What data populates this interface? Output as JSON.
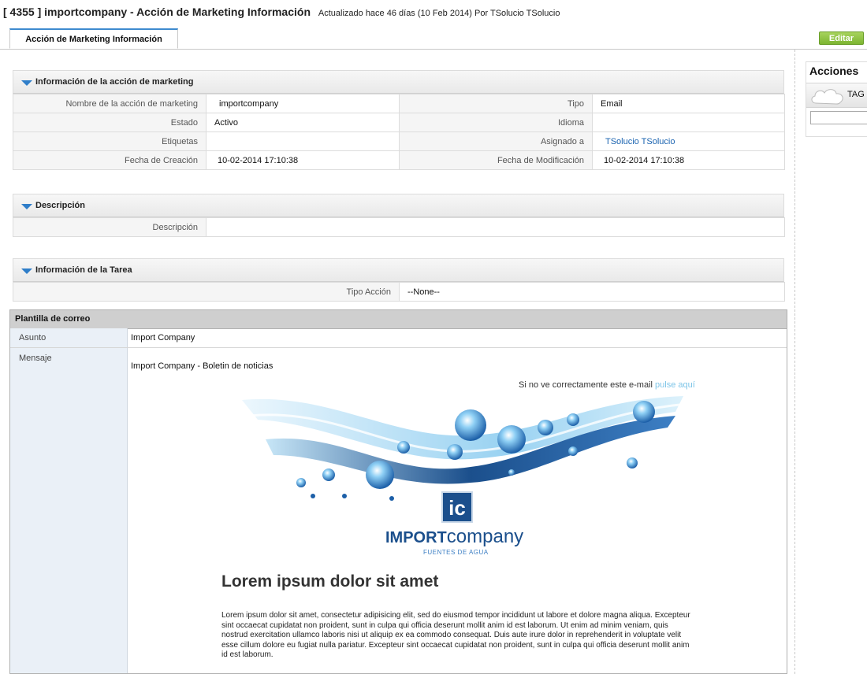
{
  "header": {
    "title": "[ 4355 ] importcompany - Acción de Marketing Información",
    "updated": "Actualizado hace 46 días (10 Feb 2014) Por TSolucio TSolucio"
  },
  "tabs": [
    {
      "label": "Acción de Marketing Información"
    }
  ],
  "edit_button": "Editar",
  "sections": {
    "marketing": {
      "title": "Información de la acción de marketing",
      "rows": [
        {
          "l1": "Nombre de la acción de marketing",
          "v1": "importcompany",
          "l2": "Tipo",
          "v2": "Email"
        },
        {
          "l1": "Estado",
          "v1": "Activo",
          "l2": "Idioma",
          "v2": ""
        },
        {
          "l1": "Etiquetas",
          "v1": "",
          "l2": "Asignado a",
          "v2": "TSolucio TSolucio"
        },
        {
          "l1": "Fecha de Creación",
          "v1": "10-02-2014 17:10:38",
          "l2": "Fecha de Modificación",
          "v2": "10-02-2014 17:10:38"
        }
      ]
    },
    "descripcion": {
      "title": "Descripción",
      "label": "Descripción",
      "value": ""
    },
    "tarea": {
      "title": "Información de la Tarea",
      "label": "Tipo Acción",
      "value": "--None--"
    }
  },
  "template": {
    "title": "Plantilla de correo",
    "subject_label": "Asunto",
    "subject": "Import Company",
    "message_label": "Mensaje",
    "email": {
      "preheader": "Import Company - Boletin de noticias",
      "view_text": "Si no ve correctamente este e-mail",
      "view_link": "pulse aquí",
      "logo_mark": "ic",
      "logo_bold": "IMPORT",
      "logo_light": "company",
      "logo_sub": "FUENTES DE AGUA",
      "heading": "Lorem ipsum dolor sit amet",
      "body": "Lorem ipsum dolor sit amet, consectetur adipisicing elit, sed do eiusmod tempor incididunt ut labore et dolore magna aliqua. Excepteur sint occaecat cupidatat non proident, sunt in culpa qui officia deserunt mollit anim id est laborum. Ut enim ad minim veniam, quis nostrud exercitation ullamco laboris nisi ut aliquip ex ea commodo consequat. Duis aute irure dolor in reprehenderit in voluptate velit esse cillum dolore eu fugiat nulla pariatur. Excepteur sint occaecat cupidatat non proident, sunt in culpa qui officia deserunt mollit anim id est laborum."
    }
  },
  "sidebar": {
    "title": "Acciones",
    "tag_label": "TAG",
    "tag_input": ""
  },
  "colors": {
    "link": "#1a63b0",
    "edit_green": "#7cb531",
    "tab_accent": "#3e8bcf",
    "logo_blue": "#1b4f8c"
  }
}
